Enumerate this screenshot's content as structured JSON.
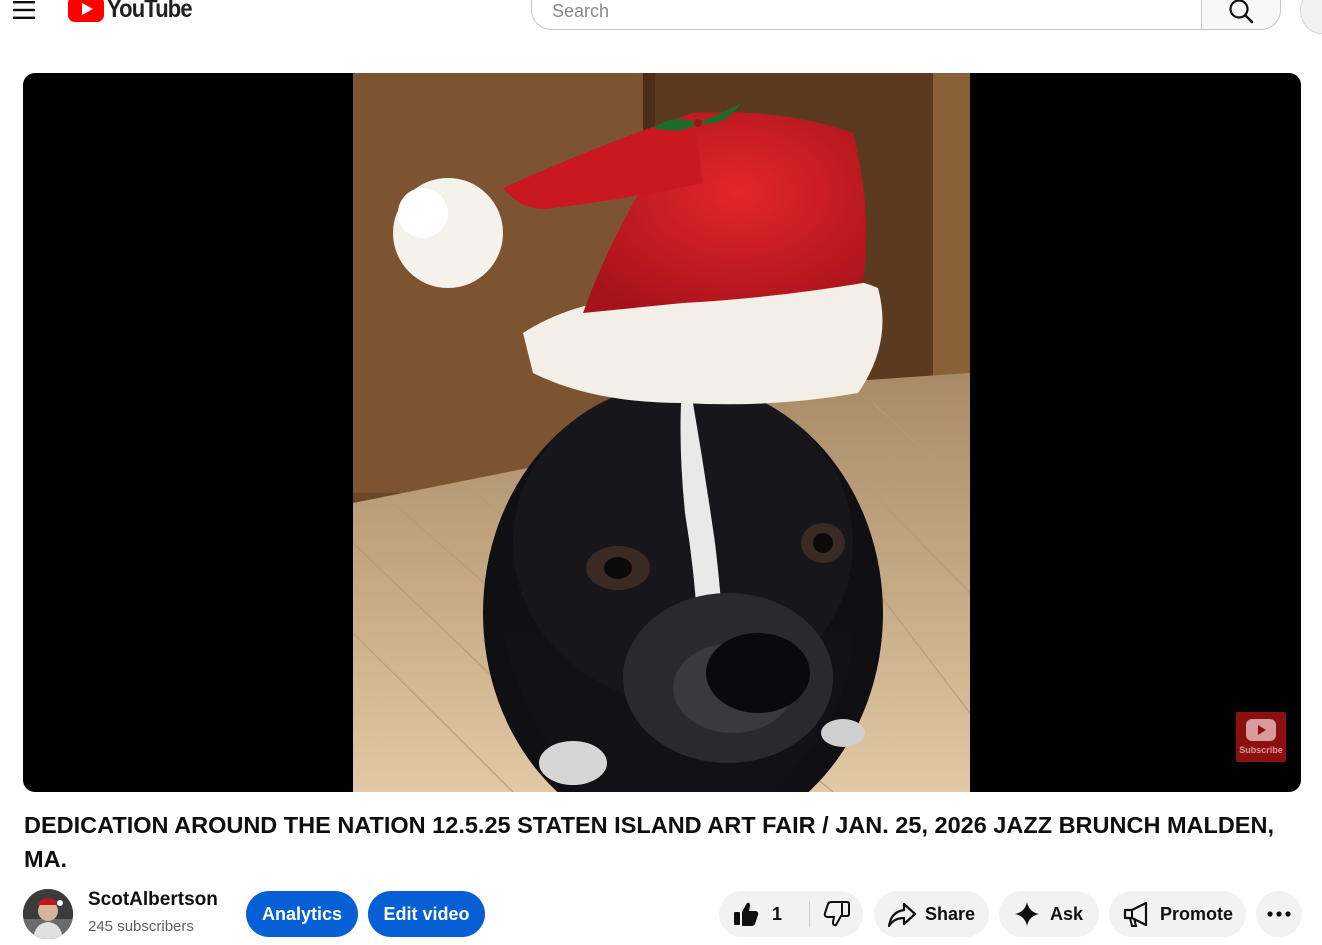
{
  "masthead": {
    "logo_text": "YouTube",
    "search_placeholder": "Search"
  },
  "player": {
    "watermark_label": "Subscribe"
  },
  "video": {
    "title": "DEDICATION AROUND THE NATION 12.5.25 STATEN ISLAND ART FAIR / JAN. 25, 2026 JAZZ BRUNCH MALDEN, MA."
  },
  "owner": {
    "channel_name": "ScotAlbertson",
    "subscribers": "245 subscribers",
    "analytics_label": "Analytics",
    "edit_label": "Edit video"
  },
  "actions": {
    "like_count": "1",
    "share_label": "Share",
    "ask_label": "Ask",
    "promote_label": "Promote"
  },
  "colors": {
    "brand_red": "#ff0000",
    "primary_blue": "#065fd4",
    "pill_bg": "#f2f2f2"
  }
}
